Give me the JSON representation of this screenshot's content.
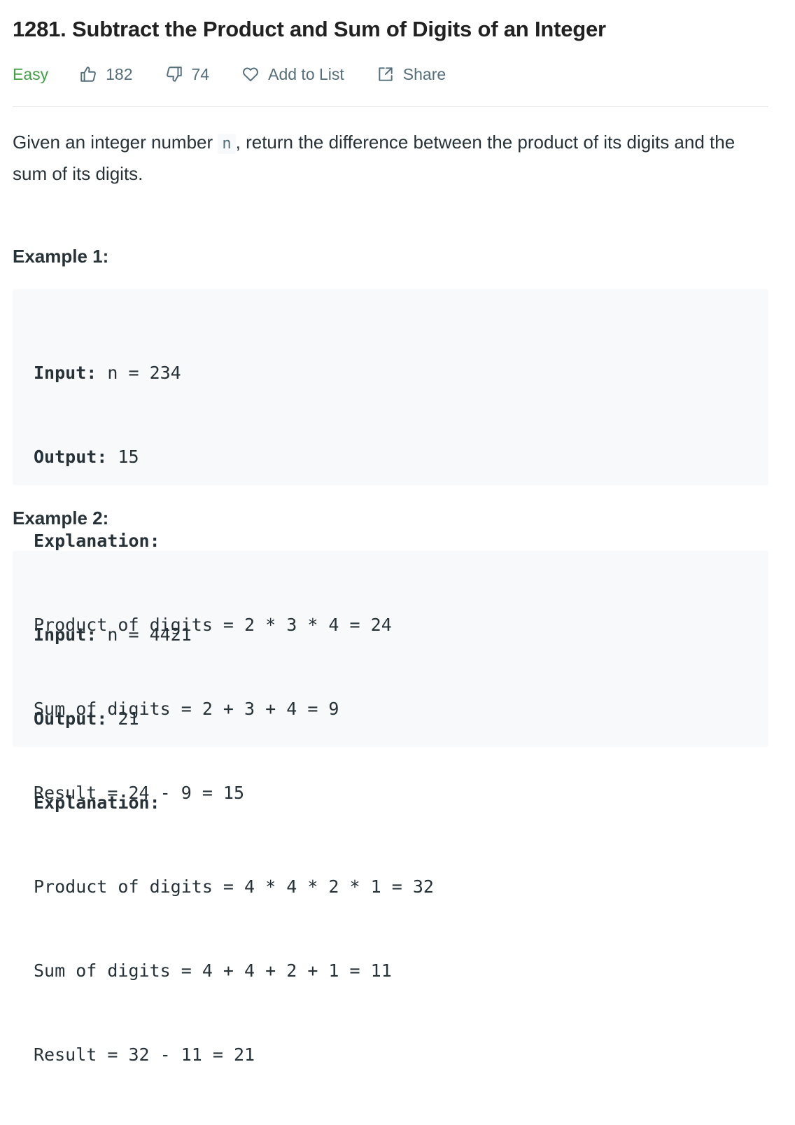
{
  "problem": {
    "title": "1281. Subtract the Product and Sum of Digits of an Integer",
    "difficulty": "Easy",
    "likes": "182",
    "dislikes": "74",
    "add_to_list_label": "Add to List",
    "share_label": "Share"
  },
  "description": {
    "before_code": "Given an integer number ",
    "code": "n",
    "after_code": ", return the difference between the product of its digits and the sum of its digits."
  },
  "examples": [
    {
      "title": "Example 1:",
      "input_label": "Input:",
      "input_value": " n = 234",
      "output_label": "Output:",
      "output_value": " 15",
      "explanation_label": "Explanation:",
      "lines": [
        "Product of digits = 2 * 3 * 4 = 24",
        "Sum of digits = 2 + 3 + 4 = 9",
        "Result = 24 - 9 = 15"
      ]
    },
    {
      "title": "Example 2:",
      "input_label": "Input:",
      "input_value": " n = 4421",
      "output_label": "Output:",
      "output_value": " 21",
      "explanation_label": "Explanation:",
      "lines": [
        "Product of digits = 4 * 4 * 2 * 1 = 32",
        "Sum of digits = 4 + 4 + 2 + 1 = 11",
        "Result = 32 - 11 = 21"
      ]
    }
  ],
  "icons": {
    "like": "thumbs-up-icon",
    "dislike": "thumbs-down-icon",
    "add_to_list": "heart-icon",
    "share": "share-icon"
  },
  "colors": {
    "difficulty_easy": "#43a047",
    "meta_text": "#546e7a",
    "code_background": "#f7f9fa"
  }
}
